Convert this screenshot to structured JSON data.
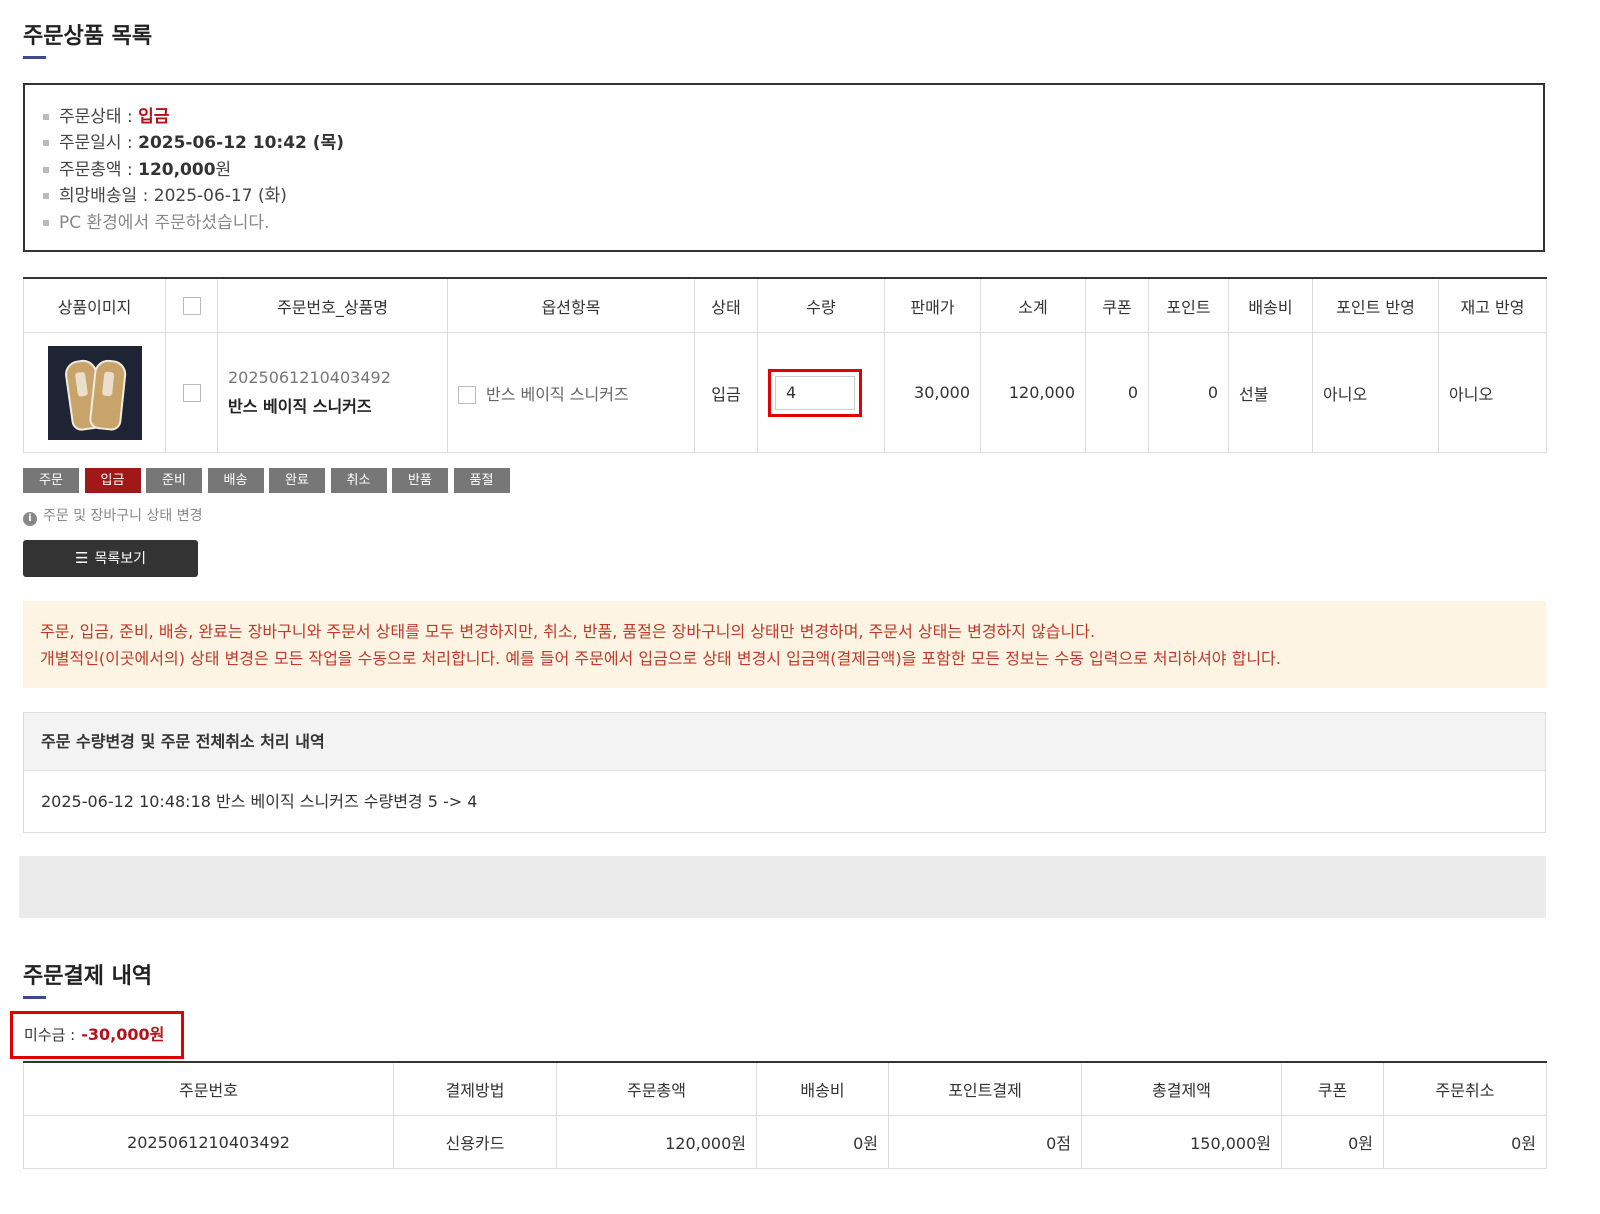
{
  "section1": {
    "title": "주문상품 목록"
  },
  "order_info": {
    "status_label": "주문상태 : ",
    "status_value": "입금",
    "date_label": "주문일시 : ",
    "date_value": "2025-06-12 10:42 (목)",
    "total_label": "주문총액 : ",
    "total_value": "120,000",
    "total_unit": "원",
    "delivery_label": "희망배송일 : ",
    "delivery_value": "2025-06-17 (화)",
    "env_text": "PC 환경에서 주문하셨습니다."
  },
  "order_table": {
    "headers": [
      "상품이미지",
      "주문번호_상품명",
      "옵션항목",
      "상태",
      "수량",
      "판매가",
      "소계",
      "쿠폰",
      "포인트",
      "배송비",
      "포인트 반영",
      "재고 반영"
    ],
    "row": {
      "order_no": "2025061210403492",
      "product_name": "반스 베이직 스니커즈",
      "option": "반스 베이직 스니커즈",
      "status": "입금",
      "qty": "4",
      "price": "30,000",
      "subtotal": "120,000",
      "coupon": "0",
      "point": "0",
      "shipping": "선불",
      "point_apply": "아니오",
      "stock_apply": "아니오"
    }
  },
  "status_buttons": [
    "주문",
    "입금",
    "준비",
    "배송",
    "완료",
    "취소",
    "반품",
    "품절"
  ],
  "status_active": "입금",
  "hint": "주문 및 장바구니 상태 변경",
  "list_button": "목록보기",
  "notice": {
    "line1": "주문, 입금, 준비, 배송, 완료는 장바구니와 주문서 상태를 모두 변경하지만, 취소, 반품, 품절은 장바구니의 상태만 변경하며, 주문서 상태는 변경하지 않습니다.",
    "line2": "개별적인(이곳에서의) 상태 변경은 모든 작업을 수동으로 처리합니다. 예를 들어 주문에서 입금으로 상태 변경시 입금액(결제금액)을 포함한 모든 정보는 수동 입력으로 처리하셔야 합니다."
  },
  "log": {
    "title": "주문 수량변경 및 주문 전체취소 처리 내역",
    "entry": "2025-06-12 10:48:18 반스 베이직 스니커즈 수량변경 5 -> 4"
  },
  "section2": {
    "title": "주문결제 내역"
  },
  "unpaid": {
    "label": "미수금 :",
    "amount": "-30,000원"
  },
  "pay_table": {
    "headers": [
      "주문번호",
      "결제방법",
      "주문총액",
      "배송비",
      "포인트결제",
      "총결제액",
      "쿠폰",
      "주문취소"
    ],
    "row": {
      "order_no": "2025061210403492",
      "method": "신용카드",
      "total": "120,000원",
      "shipping": "0원",
      "point": "0점",
      "paid": "150,000원",
      "coupon": "0원",
      "cancel": "0원"
    }
  },
  "colors": {
    "accent_red": "#b3121b",
    "highlight_red": "#e00000",
    "title_bar": "#3a4a8c",
    "notice_bg": "#fdf4e3"
  },
  "icons": {
    "hint": "info-icon",
    "list": "list-icon",
    "bullet": "bullet-icon"
  }
}
